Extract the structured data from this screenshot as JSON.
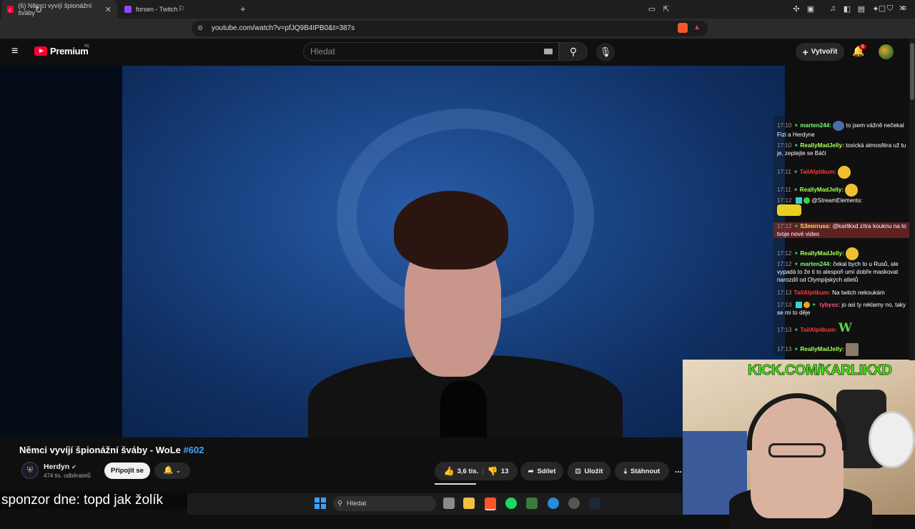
{
  "browser": {
    "tabs": [
      {
        "title": "(6) Němci vyvíjí špionážní šváby",
        "active": true,
        "favicon_color": "#ff0033"
      },
      {
        "title": "forsen - Twitch",
        "active": false,
        "favicon_color": "#9146ff"
      }
    ],
    "new_tab": "+",
    "url": "youtube.com/watch?v=pfJQ9B4IPB0&t=387s"
  },
  "youtube": {
    "brand": "Premium",
    "region": "NL",
    "search_placeholder": "Hledat",
    "create_label": "Vytvořit",
    "notifications": "6"
  },
  "chat": [
    {
      "time": "17:10",
      "user": "marten244:",
      "user_color": "#7cfc7c",
      "text": "to jsem vážně nečekal Fizi a Herdyne"
    },
    {
      "time": "17:10",
      "user": "ReallyMadJelly:",
      "user_color": "#a8ff5a",
      "text": "toxická atmosféra už tu je, zeptejte se Báči"
    },
    {
      "time": "17:11",
      "user": "TailAlpitkum:",
      "user_color": "#ff3b3b",
      "text": ""
    },
    {
      "time": "17:11",
      "user": "ReallyMadJelly:",
      "user_color": "#a8ff5a",
      "text": ""
    },
    {
      "time": "17:12",
      "user": "",
      "user_color": "#ffffff",
      "text": "@StreamElements:"
    },
    {
      "time": "17:12",
      "user": "S3mirruss:",
      "user_color": "#ffe066",
      "text": "@karlikxd zítra kouknu na to tvoje nové video"
    },
    {
      "time": "17:12",
      "user": "ReallyMadJelly:",
      "user_color": "#a8ff5a",
      "text": ""
    },
    {
      "time": "17:12",
      "user": "marten244:",
      "user_color": "#7cfc7c",
      "text": "čekal bych to u Rusů, ale vypadá to že ti to alespoň umí dobře maskovat narozdíl od Olympijských atletů"
    },
    {
      "time": "17:13",
      "user": "TailAlpitkum:",
      "user_color": "#ff3b3b",
      "text": "Na twitch nekoukám"
    },
    {
      "time": "17:13",
      "user": "tybyss:",
      "user_color": "#ff5577",
      "text": "jo asi ty reklamy no, taky se mi to děje"
    },
    {
      "time": "17:13",
      "user": "TailAlpitkum:",
      "user_color": "#ff3b3b",
      "text": "W"
    },
    {
      "time": "17:13",
      "user": "ReallyMadJelly:",
      "user_color": "#a8ff5a",
      "text": ""
    }
  ],
  "video": {
    "title": "Němci vyvíjí špionážní šváby - WoLe",
    "tag": "#602",
    "channel": "Herdyn",
    "subscribers": "474 tis. odběratelů",
    "join_label": "Připojit se",
    "likes": "3,6 tis.",
    "dislikes": "13",
    "share_label": "Sdílet",
    "save_label": "Uložit",
    "download_label": "Stáhnout",
    "more": "..."
  },
  "subtitle": "sponzor dne: topd jak žolík",
  "taskbar": {
    "search_label": "Hledat"
  },
  "webcam": {
    "overlay_text": "KICK.COM/KARLIKXD"
  }
}
